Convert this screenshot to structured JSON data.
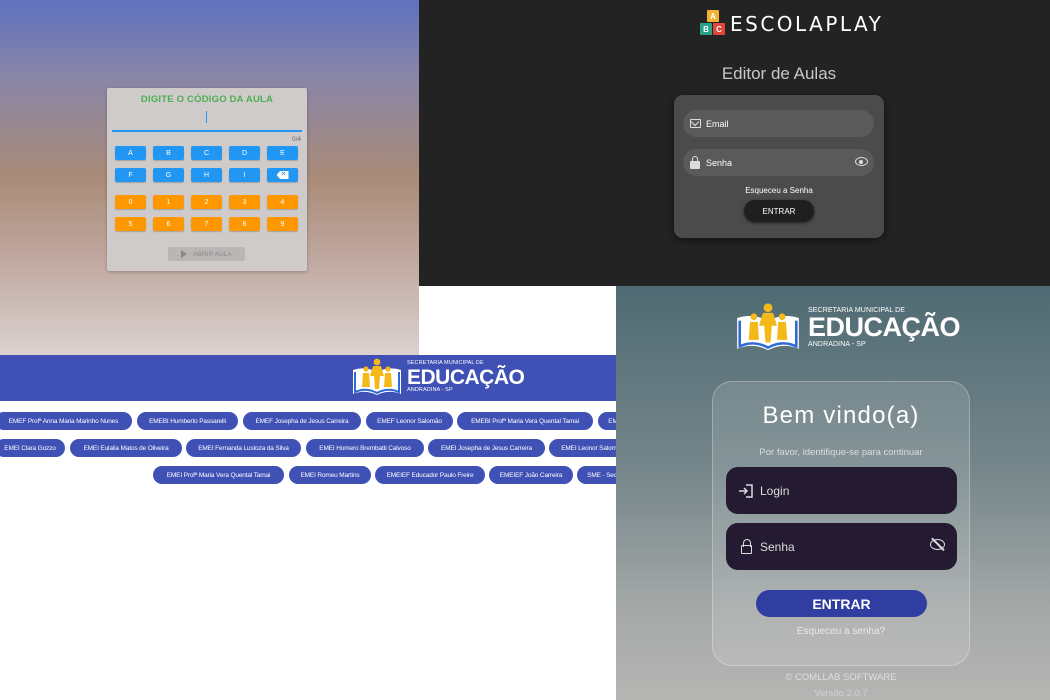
{
  "code_panel": {
    "title": "DIGITE O CÓDIGO DA AULA",
    "counter": "0/4",
    "letter_rows": [
      [
        "A",
        "B",
        "C",
        "D",
        "E"
      ],
      [
        "F",
        "G",
        "H",
        "I"
      ]
    ],
    "number_rows": [
      [
        "0",
        "1",
        "2",
        "3",
        "4"
      ],
      [
        "5",
        "6",
        "7",
        "8",
        "9"
      ]
    ],
    "backspace_icon": "backspace-icon",
    "open_button": "ABRIR AULA",
    "colors": {
      "letters": "#2196f3",
      "numbers": "#ff9800",
      "title": "#4caf50"
    }
  },
  "escolaplay": {
    "logo_blocks": [
      "A",
      "B",
      "C"
    ],
    "brand": "ESCOLAPLAY",
    "heading": "Editor de Aulas",
    "email_label": "Email",
    "password_label": "Senha",
    "forgot": "Esqueceu a Senha",
    "enter": "ENTRAR"
  },
  "school_list": {
    "logo": {
      "small": "SECRETARIA MUNICIPAL DE",
      "big": "EDUCAÇÃO",
      "place": "ANDRADINA - SP"
    },
    "rows": [
      [
        "EMEF Profª Anna Maria Marinho Nunes",
        "EMEBI Humberto Passarelli",
        "EMEF Josepha de Jesus Carreira",
        "EMEF Leonor Salomão",
        "EMEBI Profª Maria Vera Quental Tamai",
        "EM"
      ],
      [
        "EMEI Clara Gozzo",
        "EMEI Eulalia Matos de Oliveira",
        "EMEI Fernanda Lustoza da Silva",
        "EMEI Homero Brembatti Calvoso",
        "EMEI Josepha de Jesus Carreira",
        "EMEI Leonor Salom"
      ],
      [
        "EMEI Profª Maria Vera Quental Tamai",
        "EMEI Romeu Martins",
        "EMEIEF Educador Paulo Freire",
        "EMEIEF João Carreira",
        "SME - Sec"
      ]
    ],
    "chip_color": "#3f51b5"
  },
  "login": {
    "logo": {
      "small": "SECRETARIA MUNICIPAL DE",
      "big": "EDUCAÇÃO",
      "place": "ANDRADINA - SP"
    },
    "welcome": "Bem vindo(a)",
    "subtitle": "Por favor, identifique-se para continuar",
    "login_placeholder": "Login",
    "password_placeholder": "Senha",
    "enter": "ENTRAR",
    "forgot": "Esqueceu a senha?",
    "copyright": "© COMLLAB SOFTWARE",
    "version": "Versão 2.0.7"
  }
}
